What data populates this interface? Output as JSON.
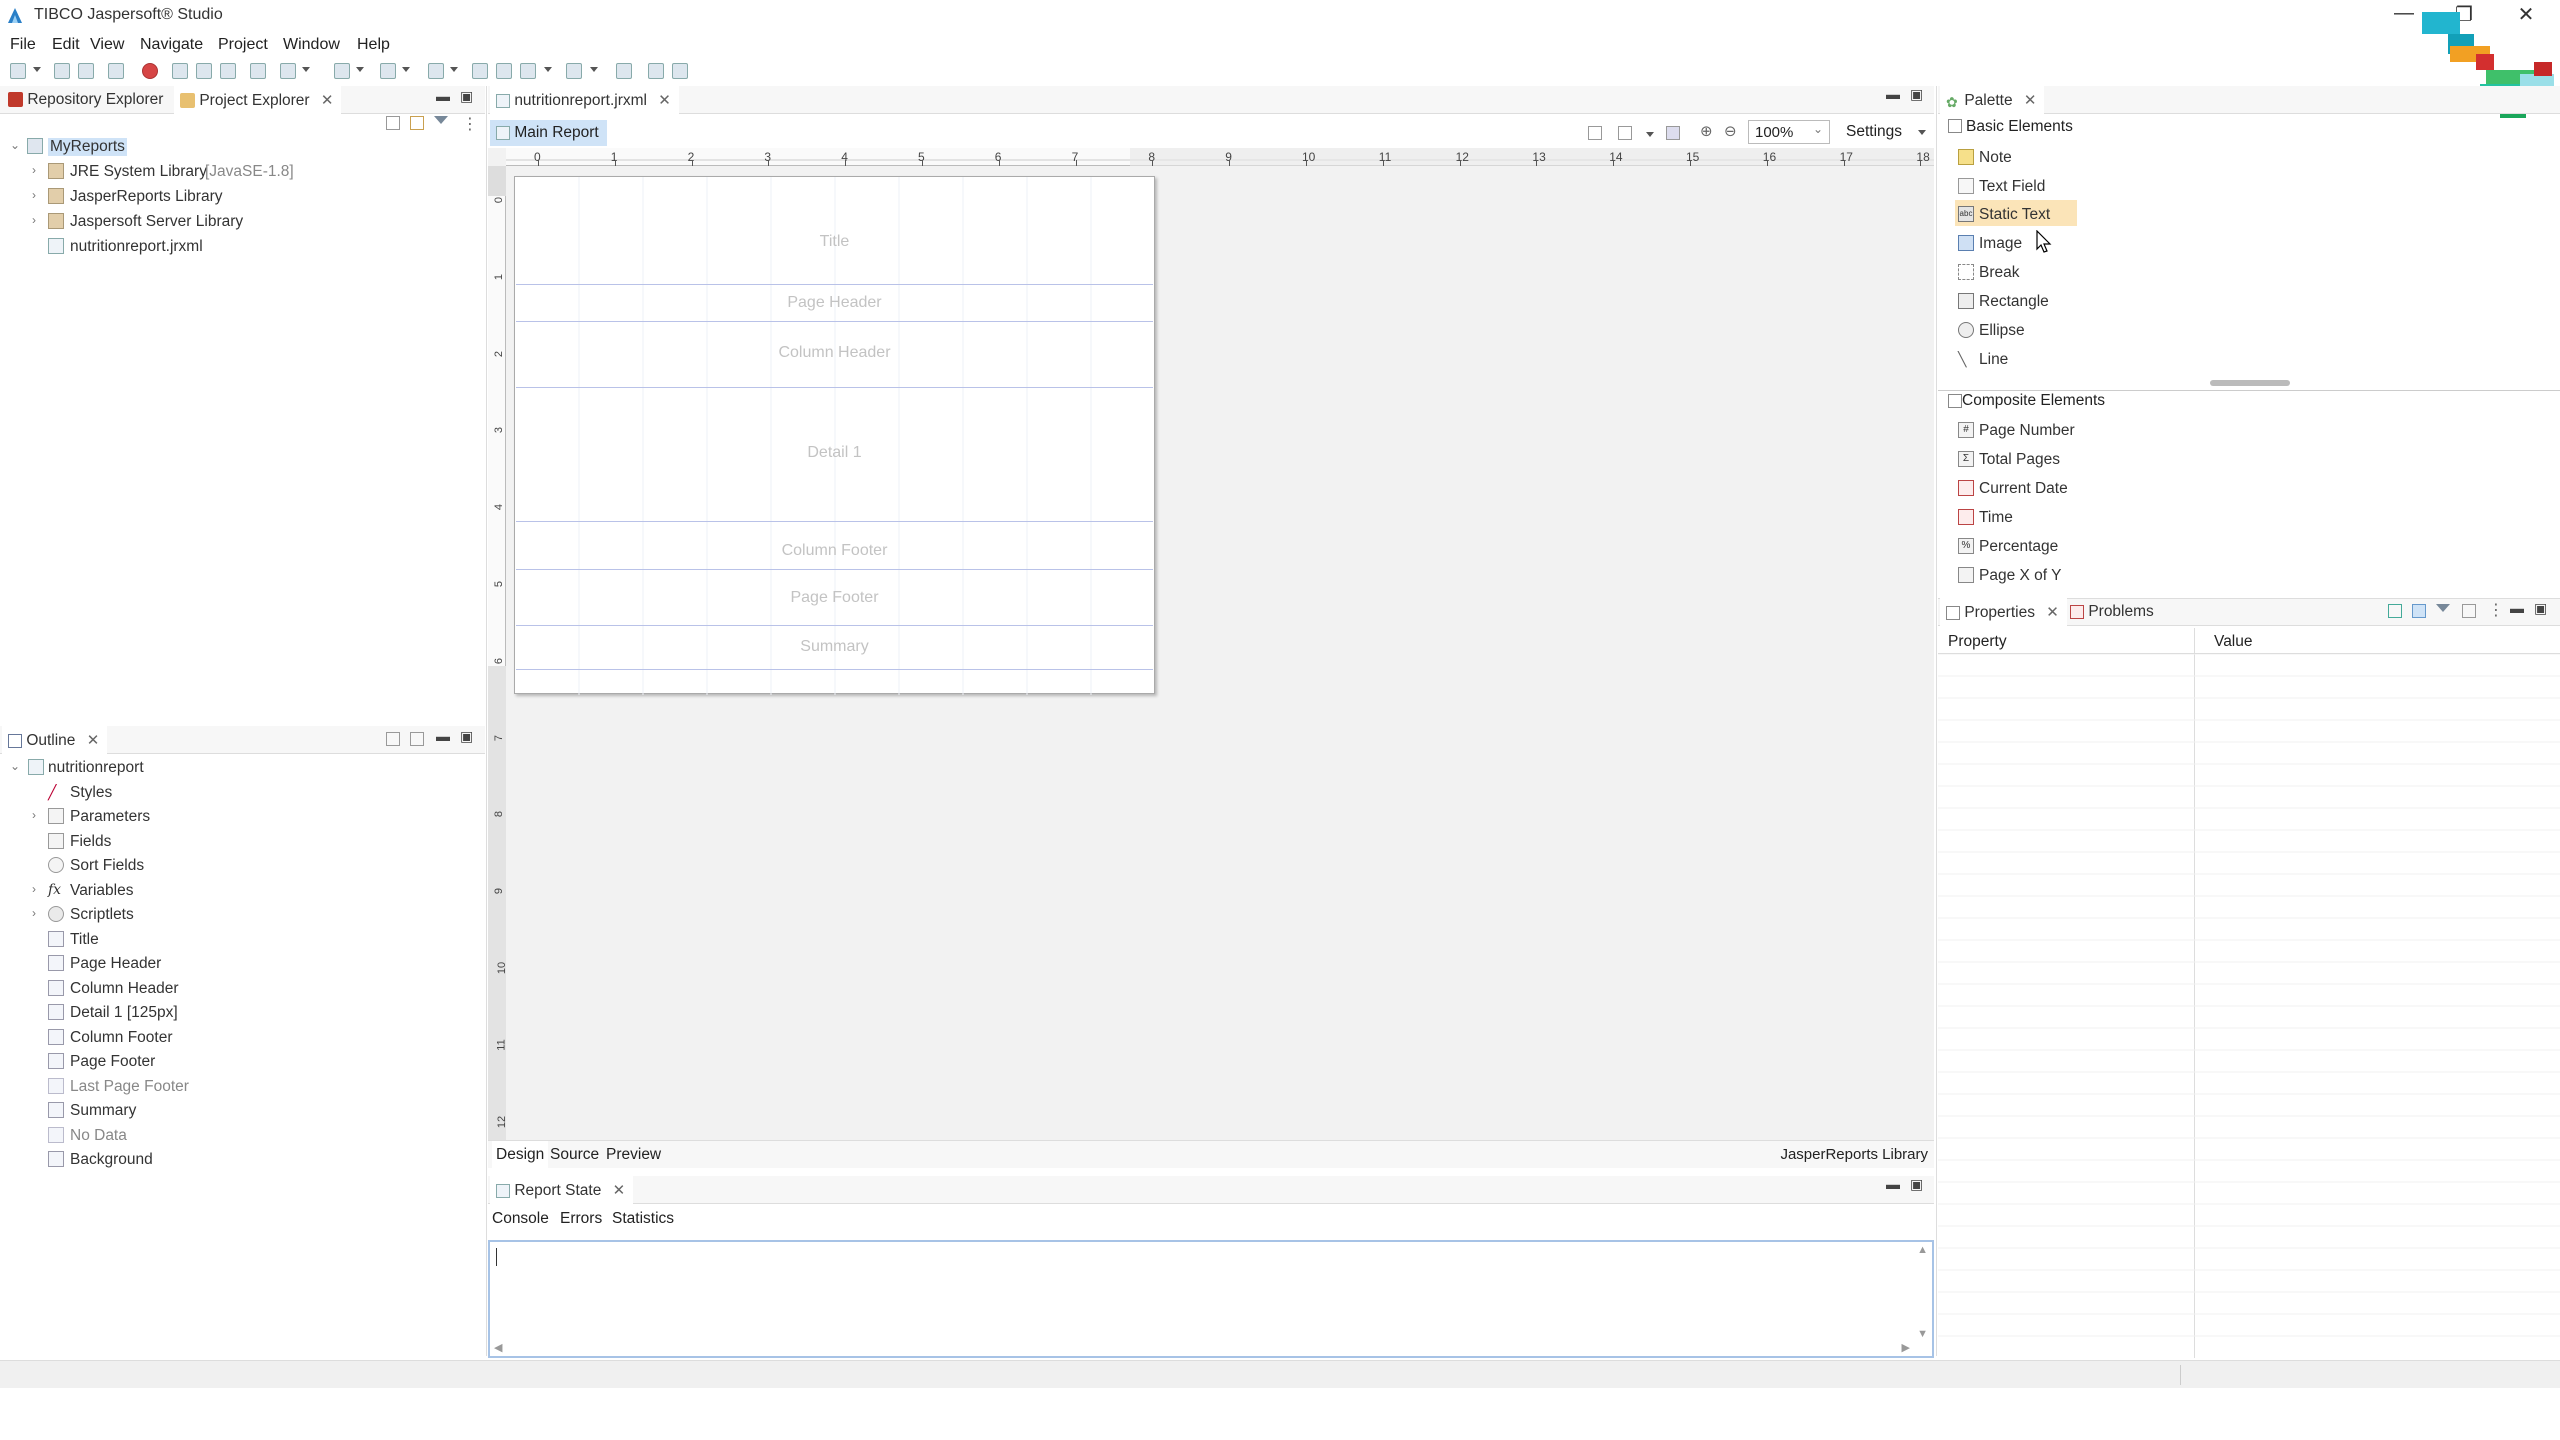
{
  "window": {
    "title": "TIBCO Jaspersoft® Studio",
    "controls": [
      "—",
      "❐",
      "✕"
    ]
  },
  "menu": [
    "File",
    "Edit",
    "View",
    "Navigate",
    "Project",
    "Window",
    "Help"
  ],
  "left_top": {
    "tabs": [
      {
        "label": "Repository Explorer"
      },
      {
        "label": "Project Explorer"
      }
    ],
    "tree": [
      {
        "label": "MyReports",
        "extra": ""
      },
      {
        "label": "JRE System Library",
        "extra": "[JavaSE-1.8]"
      },
      {
        "label": "JasperReports Library",
        "extra": ""
      },
      {
        "label": "Jaspersoft Server Library",
        "extra": ""
      },
      {
        "label": "nutritionreport.jrxml",
        "extra": ""
      }
    ]
  },
  "outline": {
    "tab": "Outline",
    "items": [
      {
        "label": "nutritionreport"
      },
      {
        "label": "Styles"
      },
      {
        "label": "Parameters"
      },
      {
        "label": "Fields"
      },
      {
        "label": "Sort Fields"
      },
      {
        "label": "Variables"
      },
      {
        "label": "Scriptlets"
      },
      {
        "label": "Title"
      },
      {
        "label": "Page Header"
      },
      {
        "label": "Column Header"
      },
      {
        "label": "Detail 1 [125px]"
      },
      {
        "label": "Column Footer"
      },
      {
        "label": "Page Footer"
      },
      {
        "label": "Last Page Footer"
      },
      {
        "label": "Summary"
      },
      {
        "label": "No Data"
      },
      {
        "label": "Background"
      }
    ]
  },
  "editor": {
    "file_tab": "nutritionreport.jrxml",
    "main_report_tab": "Main Report",
    "zoom": "100%",
    "settings_label": "Settings",
    "ruler": [
      "0",
      "1",
      "2",
      "3",
      "4",
      "5",
      "6",
      "7",
      "8",
      "9",
      "10",
      "11",
      "12",
      "13",
      "14",
      "15",
      "16",
      "17",
      "18"
    ],
    "vruler": [
      "0",
      "1",
      "2",
      "3",
      "4",
      "5",
      "6",
      "7",
      "8",
      "9",
      "10",
      "11",
      "12"
    ],
    "bands": [
      "Title",
      "Page Header",
      "Column Header",
      "Detail 1",
      "Column Footer",
      "Page Footer",
      "Summary"
    ],
    "bottom_tabs": [
      "Design",
      "Source",
      "Preview"
    ],
    "status_right": "JasperReports Library"
  },
  "palette": {
    "tab": "Palette",
    "basic_header": "Basic Elements",
    "basic_items": [
      {
        "label": "Note",
        "icon": "note-icon"
      },
      {
        "label": "Text Field",
        "icon": "text-field-icon"
      },
      {
        "label": "Static Text",
        "icon": "static-text-icon"
      },
      {
        "label": "Image",
        "icon": "image-icon"
      },
      {
        "label": "Break",
        "icon": "break-icon"
      },
      {
        "label": "Rectangle",
        "icon": "rectangle-icon"
      },
      {
        "label": "Ellipse",
        "icon": "ellipse-icon"
      },
      {
        "label": "Line",
        "icon": "line-icon"
      }
    ],
    "composite_header": "Composite Elements",
    "composite_items": [
      {
        "label": "Page Number",
        "icon": "page-number-icon"
      },
      {
        "label": "Total Pages",
        "icon": "total-pages-icon"
      },
      {
        "label": "Current Date",
        "icon": "current-date-icon"
      },
      {
        "label": "Time",
        "icon": "time-icon"
      },
      {
        "label": "Percentage",
        "icon": "percentage-icon"
      },
      {
        "label": "Page X of Y",
        "icon": "page-x-of-y-icon"
      }
    ]
  },
  "properties": {
    "tabs": [
      "Properties",
      "Problems"
    ],
    "columns": [
      "Property",
      "Value"
    ]
  },
  "report_state": {
    "tab": "Report State",
    "subtabs": [
      "Console",
      "Errors",
      "Statistics"
    ]
  },
  "colors": {
    "selection": "#fbe4b8",
    "band_line": "#b9c2e8",
    "tab_active": "#ffffff"
  }
}
